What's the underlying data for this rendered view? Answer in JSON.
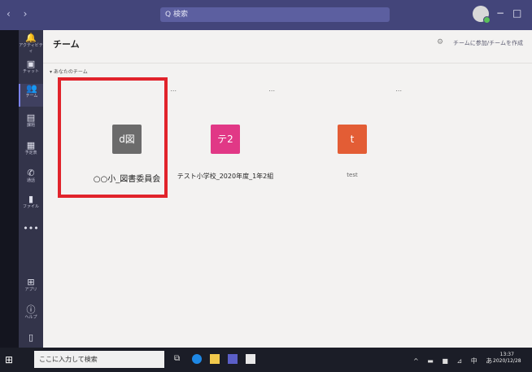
{
  "titlebar": {
    "nav_arrows": "‹ ›",
    "search_placeholder": "Q 検索",
    "minimize": "−",
    "maximize": "□"
  },
  "rail": {
    "items": [
      {
        "label": "アクティビティ",
        "icon": "bell-icon",
        "glyph": "🔔"
      },
      {
        "label": "チャット",
        "icon": "chat-icon",
        "glyph": "▣"
      },
      {
        "label": "チーム",
        "icon": "teams-icon",
        "glyph": "👥"
      },
      {
        "label": "課題",
        "icon": "assignments-icon",
        "glyph": "▤"
      },
      {
        "label": "予定表",
        "icon": "calendar-icon",
        "glyph": "▦"
      },
      {
        "label": "通話",
        "icon": "phone-icon",
        "glyph": "✆"
      },
      {
        "label": "ファイル",
        "icon": "file-icon",
        "glyph": "▮"
      },
      {
        "label": "",
        "icon": "more-icon",
        "glyph": "•••"
      }
    ],
    "apps_label": "アプリ",
    "help_label": "ヘルプ"
  },
  "main": {
    "title": "チーム",
    "header_action": "チームに参加/チームを作成",
    "section_label": "▾ あなたのチーム",
    "teams": [
      {
        "name": "○○小_図書委員会",
        "avatar_text": "d図",
        "color": "#6b6b6b"
      },
      {
        "name": "テスト小学校_2020年度_1年2組",
        "avatar_text": "テ2",
        "color": "#e13886"
      },
      {
        "name": "test",
        "avatar_text": "t",
        "color": "#e35d35"
      }
    ],
    "more_label": "..."
  },
  "taskbar": {
    "search_placeholder": "ここに入力して検索",
    "tray_text": "^ ▬ ■ ⊿ 中 あ",
    "time": "13:37",
    "date": "2020/12/28"
  },
  "colors": {
    "titlebar": "#43457a",
    "highlight_box": "#e1232b"
  }
}
